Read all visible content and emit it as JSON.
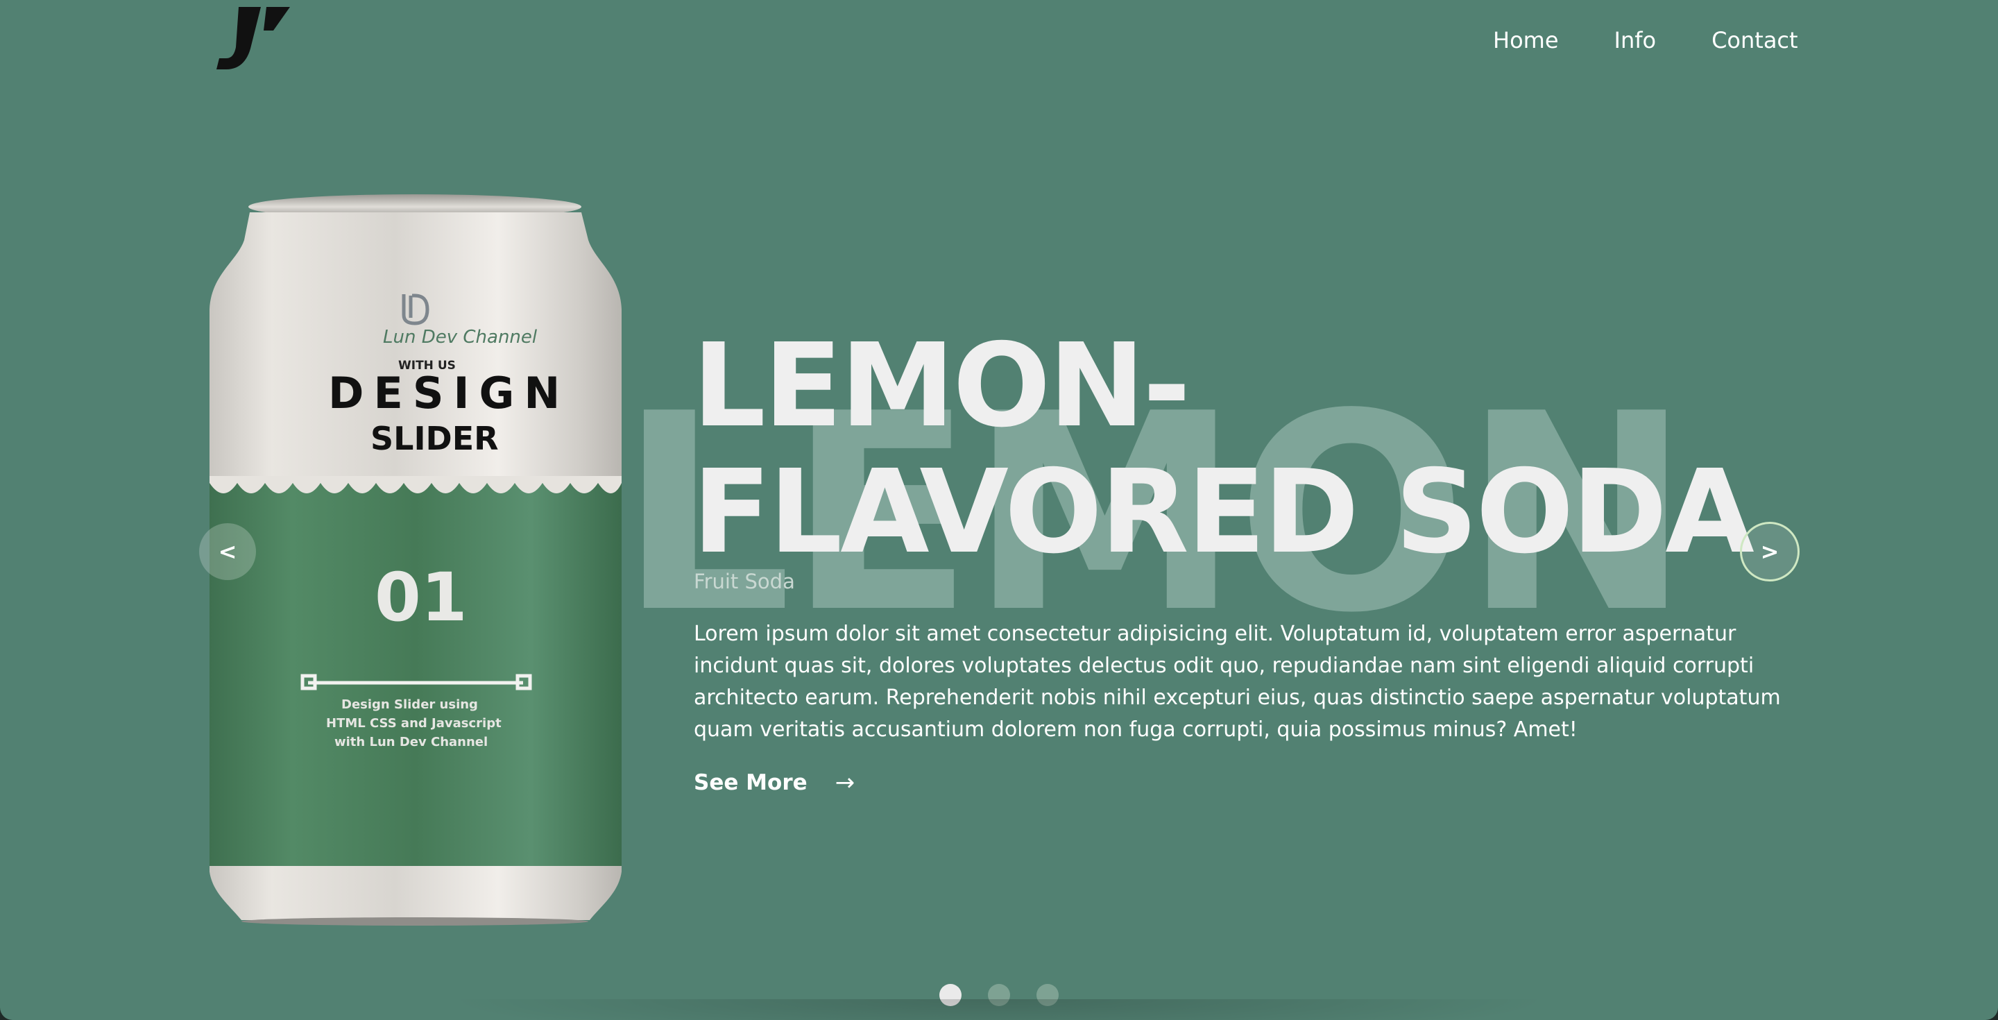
{
  "nav": {
    "items": [
      {
        "label": "Home"
      },
      {
        "label": "Info"
      },
      {
        "label": "Contact"
      }
    ]
  },
  "background_word": "LEMON",
  "can": {
    "brand": "Lun Dev Channel",
    "with_us": "WITH US",
    "design": "DESIGN",
    "slider": "SLIDER",
    "number": "01",
    "caption": [
      "Design Slider using",
      "HTML CSS and Javascript",
      "with Lun Dev Channel"
    ]
  },
  "hero": {
    "title_line1": "LEMON-",
    "title_line2": "FLAVORED SODA",
    "subtitle": "Fruit Soda",
    "description": "Lorem ipsum dolor sit amet consectetur adipisicing elit. Voluptatum id, voluptatem error aspernatur incidunt quas sit, dolores voluptates delectus odit quo, repudiandae nam sint eligendi aliquid corrupti architecto earum. Reprehenderit nobis nihil excepturi eius, quas distinctio saepe aspernatur voluptatum quam veritatis accusantium dolorem non fuga corrupti, quia possimus minus? Amet!",
    "cta_label": "See More",
    "cta_arrow": "→"
  },
  "controls": {
    "prev": "<",
    "next": ">"
  },
  "pagination": {
    "count": 3,
    "active_index": 0
  },
  "colors": {
    "background": "#528172",
    "can_green": "#4c7f5c",
    "accent_ring": "#cfe8c3"
  }
}
